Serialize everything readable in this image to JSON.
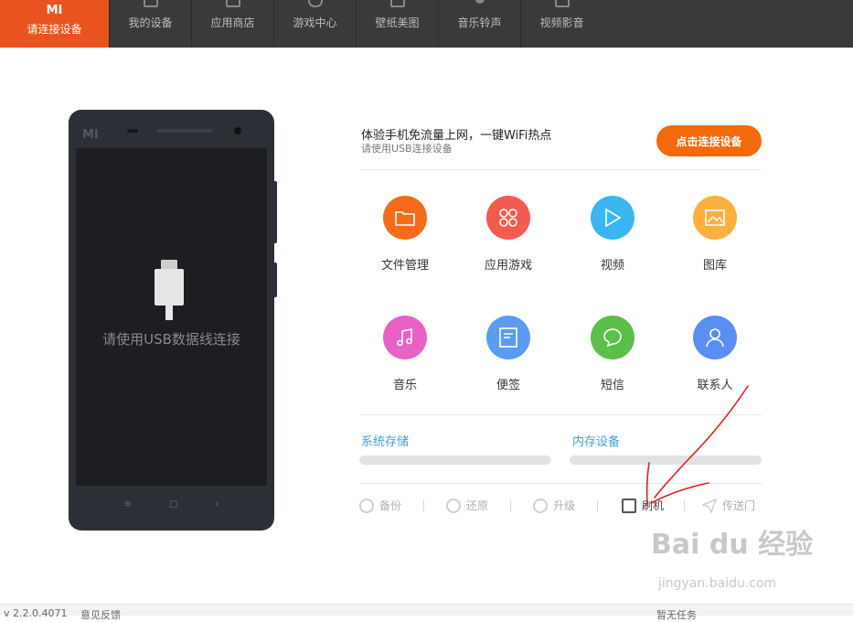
{
  "topnav": {
    "brand_logo": "MI",
    "brand_label": "请连接设备",
    "items": [
      {
        "label": "我的设备",
        "icon": "phone-icon"
      },
      {
        "label": "应用商店",
        "icon": "bag-icon"
      },
      {
        "label": "游戏中心",
        "icon": "gamepad-icon"
      },
      {
        "label": "壁纸美图",
        "icon": "picture-icon"
      },
      {
        "label": "音乐铃声",
        "icon": "music-note-icon"
      },
      {
        "label": "视频影音",
        "icon": "play-icon"
      }
    ]
  },
  "phone": {
    "logo": "MI",
    "screen_text": "请使用USB数据线连接",
    "softkeys": [
      "≡",
      "▢",
      "‹"
    ]
  },
  "promo": {
    "title": "体验手机免流量上网，一键WiFi热点",
    "subtitle": "请使用USB连接设备",
    "button": "点击连接设备",
    "button_color": "#f26a0b"
  },
  "apps": [
    {
      "label": "文件管理",
      "icon": "folder-icon",
      "color": "#f46c1a"
    },
    {
      "label": "应用游戏",
      "icon": "apps-grid-icon",
      "color": "#f25b4e"
    },
    {
      "label": "视频",
      "icon": "play-icon",
      "color": "#3cb6f0"
    },
    {
      "label": "图库",
      "icon": "picture-icon",
      "color": "#fdb040"
    },
    {
      "label": "音乐",
      "icon": "music-note-icon",
      "color": "#e961c5"
    },
    {
      "label": "便签",
      "icon": "note-icon",
      "color": "#5a9cf2"
    },
    {
      "label": "短信",
      "icon": "chat-bubble-icon",
      "color": "#5bbf4a"
    },
    {
      "label": "联系人",
      "icon": "person-icon",
      "color": "#5b8ef2"
    }
  ],
  "storage": {
    "system_label": "系统存储",
    "internal_label": "内存设备"
  },
  "tools": [
    {
      "label": "备份",
      "icon": "backup-icon"
    },
    {
      "label": "还原",
      "icon": "restore-icon"
    },
    {
      "label": "升级",
      "icon": "upgrade-icon"
    },
    {
      "label": "刷机",
      "icon": "flash-icon"
    },
    {
      "label": "传送门",
      "icon": "send-icon"
    }
  ],
  "statusbar": {
    "version": "v 2.2.0.4071",
    "feedback": "意见反馈",
    "downloads": "暂无任务"
  },
  "watermark": {
    "brand": "Bai du 经验",
    "url": "jingyan.baidu.com"
  }
}
